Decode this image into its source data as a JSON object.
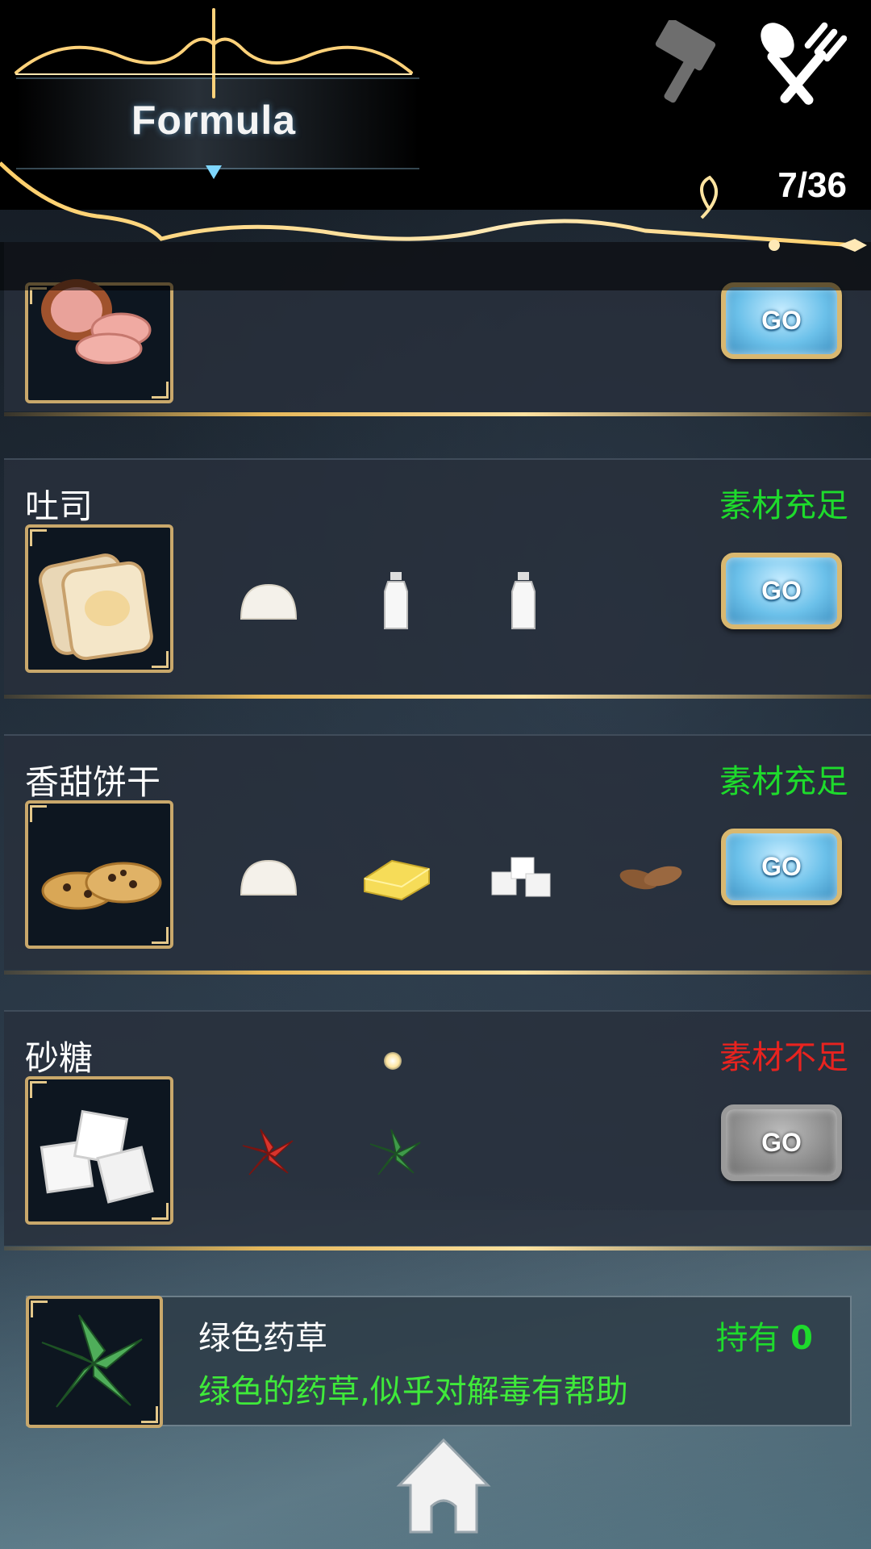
{
  "header": {
    "title": "Formula",
    "counter": "7/36",
    "icons": [
      "hammer-icon",
      "fork-spoon-icon"
    ]
  },
  "recipes": [
    {
      "name": "",
      "status": "",
      "go_label": "GO",
      "ingredients": []
    },
    {
      "name": "吐司",
      "status": "素材充足",
      "status_color": "#1edb2c",
      "go_label": "GO",
      "ingredients": [
        "dough-icon",
        "milk-bottle-icon",
        "milk-bottle-icon"
      ]
    },
    {
      "name": "香甜饼干",
      "status": "素材充足",
      "status_color": "#1edb2c",
      "go_label": "GO",
      "ingredients": [
        "dough-icon",
        "butter-icon",
        "sugar-cubes-icon",
        "almonds-icon"
      ]
    },
    {
      "name": "砂糖",
      "status": "素材不足",
      "status_color": "#e8231f",
      "go_label": "GO",
      "ingredients": [
        "red-herb-icon",
        "green-herb-icon"
      ]
    }
  ],
  "item_detail": {
    "name": "绿色药草",
    "held_label": "持有",
    "held_count": "0",
    "description": "绿色的药草,似乎对解毒有帮助"
  },
  "colors": {
    "ok": "#1edb2c",
    "bad": "#e8231f",
    "gold": "#e6b85a",
    "go_blue": "#6cc1ea"
  }
}
